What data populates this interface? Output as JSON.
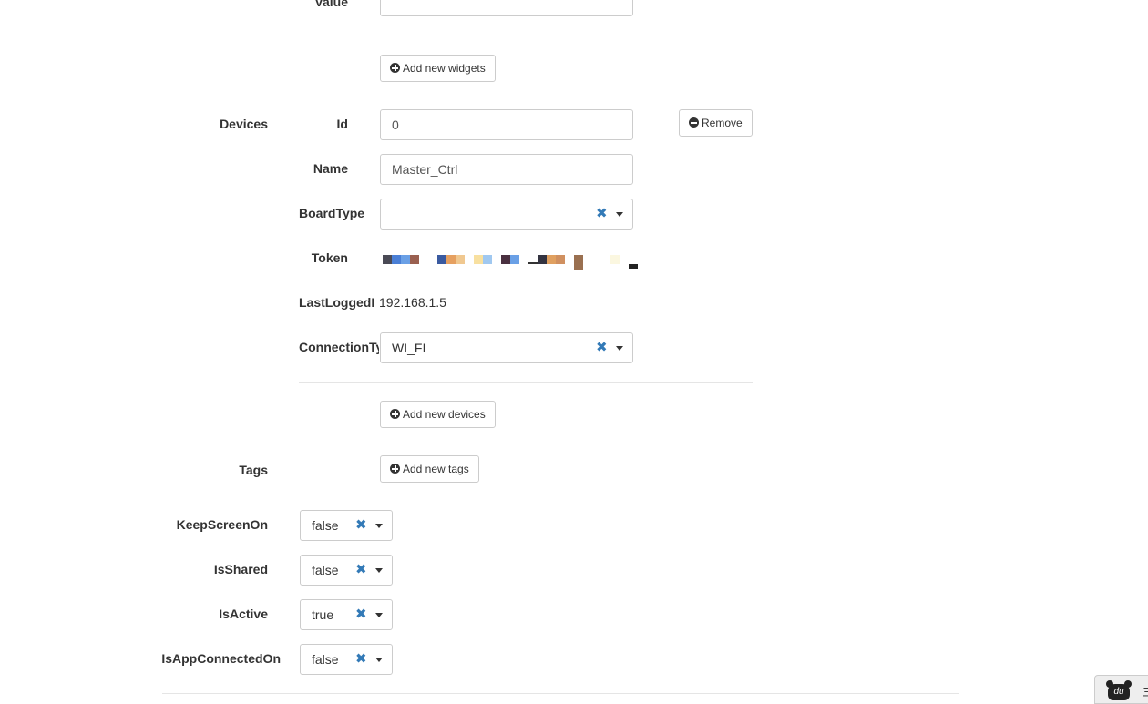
{
  "widgets": {
    "value_label": "Value",
    "value_input": "",
    "add_button": "Add new widgets"
  },
  "devices": {
    "section_label": "Devices",
    "remove_button": "Remove",
    "fields": {
      "id": {
        "label": "Id",
        "value": "0"
      },
      "name": {
        "label": "Name",
        "value": "Master_Ctrl"
      },
      "board_type": {
        "label": "BoardType",
        "value": ""
      },
      "token": {
        "label": "Token"
      },
      "last_logged_ip": {
        "label": "LastLoggedIP",
        "value": "192.168.1.5"
      },
      "connection_type": {
        "label": "ConnectionType",
        "value": "WI_FI"
      }
    },
    "add_button": "Add new devices"
  },
  "tags": {
    "section_label": "Tags",
    "add_button": "Add new tags"
  },
  "settings": {
    "keep_screen_on": {
      "label": "KeepScreenOn",
      "value": "false"
    },
    "is_shared": {
      "label": "IsShared",
      "value": "false"
    },
    "is_active": {
      "label": "IsActive",
      "value": "true"
    },
    "is_app_connected_on": {
      "label": "IsAppConnectedOn",
      "value": "false"
    }
  },
  "icons": {
    "clear": "close-icon",
    "caret": "chevron-down-icon",
    "add": "plus-circle-icon",
    "remove": "minus-circle-icon"
  },
  "colors": {
    "clear_icon": "#337ab7",
    "border": "#cccccc",
    "text": "#333333"
  },
  "corner_widget": {
    "logo_text": "du",
    "suffix": "三"
  }
}
